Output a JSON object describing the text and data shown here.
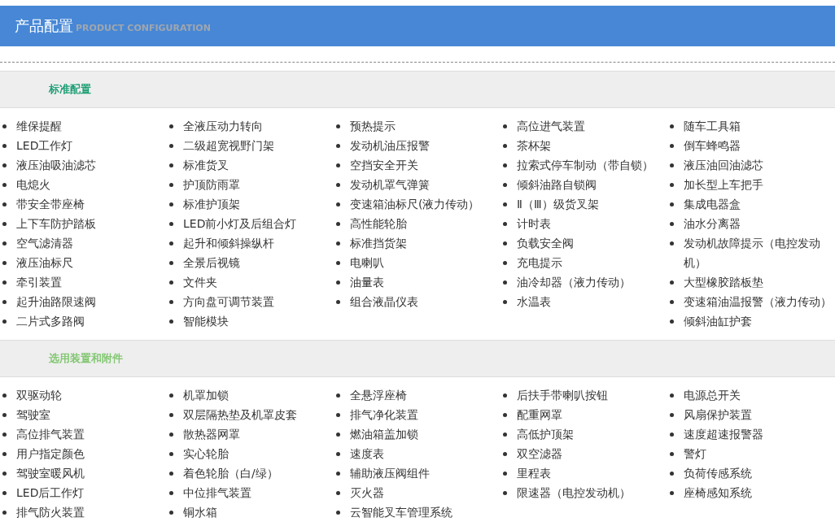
{
  "header": {
    "title": "产品配置",
    "subtitle": "PRODUCT CONFIGURATION"
  },
  "sections": [
    {
      "title": "标准配置",
      "color": "#129a6e",
      "columns": [
        [
          "维保提醒",
          "LED工作灯",
          "液压油吸油滤芯",
          "电熄火",
          "带安全带座椅",
          "上下车防护踏板",
          "空气滤清器",
          "液压油标尺",
          "牵引装置",
          "起升油路限速阀",
          "二片式多路阀"
        ],
        [
          "全液压动力转向",
          "二级超宽视野门架",
          "标准货叉",
          "护顶防雨罩",
          "标准护顶架",
          "LED前小灯及后组合灯",
          "起升和倾斜操纵杆",
          "全景后视镜",
          "文件夹",
          "方向盘可调节装置",
          "智能模块"
        ],
        [
          "预热提示",
          "发动机油压报警",
          "空挡安全开关",
          "发动机罩气弹簧",
          "变速箱油标尺(液力传动）",
          "高性能轮胎",
          "标准挡货架",
          "电喇叭",
          "油量表",
          "组合液晶仪表"
        ],
        [
          "高位进气装置",
          "茶杯架",
          "拉索式停车制动（带自锁）",
          "倾斜油路自锁阀",
          "Ⅱ（Ⅲ）级货叉架",
          "计时表",
          "负载安全阀",
          "充电提示",
          "油冷却器（液力传动）",
          "水温表"
        ],
        [
          "随车工具箱",
          "倒车蜂鸣器",
          "液压油回油滤芯",
          "加长型上车把手",
          "集成电器盒",
          "油水分离器",
          "发动机故障提示（电控发动机）",
          "大型橡胶踏板垫",
          "变速箱油温报警（液力传动）",
          "倾斜油缸护套"
        ]
      ]
    },
    {
      "title": "选用装置和附件",
      "color": "#7cc46a",
      "columns": [
        [
          "双驱动轮",
          "驾驶室",
          "高位排气装置",
          "用户指定颜色",
          "驾驶室暖风机",
          "LED后工作灯",
          "排气防火装置"
        ],
        [
          "机罩加锁",
          "双层隔热垫及机罩皮套",
          "散热器网罩",
          "实心轮胎",
          "着色轮胎（白/绿）",
          "中位排气装置",
          "铜水箱"
        ],
        [
          "全悬浮座椅",
          "排气净化装置",
          "燃油箱盖加锁",
          "速度表",
          "辅助液压阀组件",
          "灭火器",
          "云智能叉车管理系统"
        ],
        [
          "后扶手带喇叭按钮",
          "配重网罩",
          "高低护顶架",
          "双空滤器",
          "里程表",
          "限速器（电控发动机）"
        ],
        [
          "电源总开关",
          "风扇保护装置",
          "速度超速报警器",
          "警灯",
          "负荷传感系统",
          "座椅感知系统"
        ]
      ]
    }
  ]
}
